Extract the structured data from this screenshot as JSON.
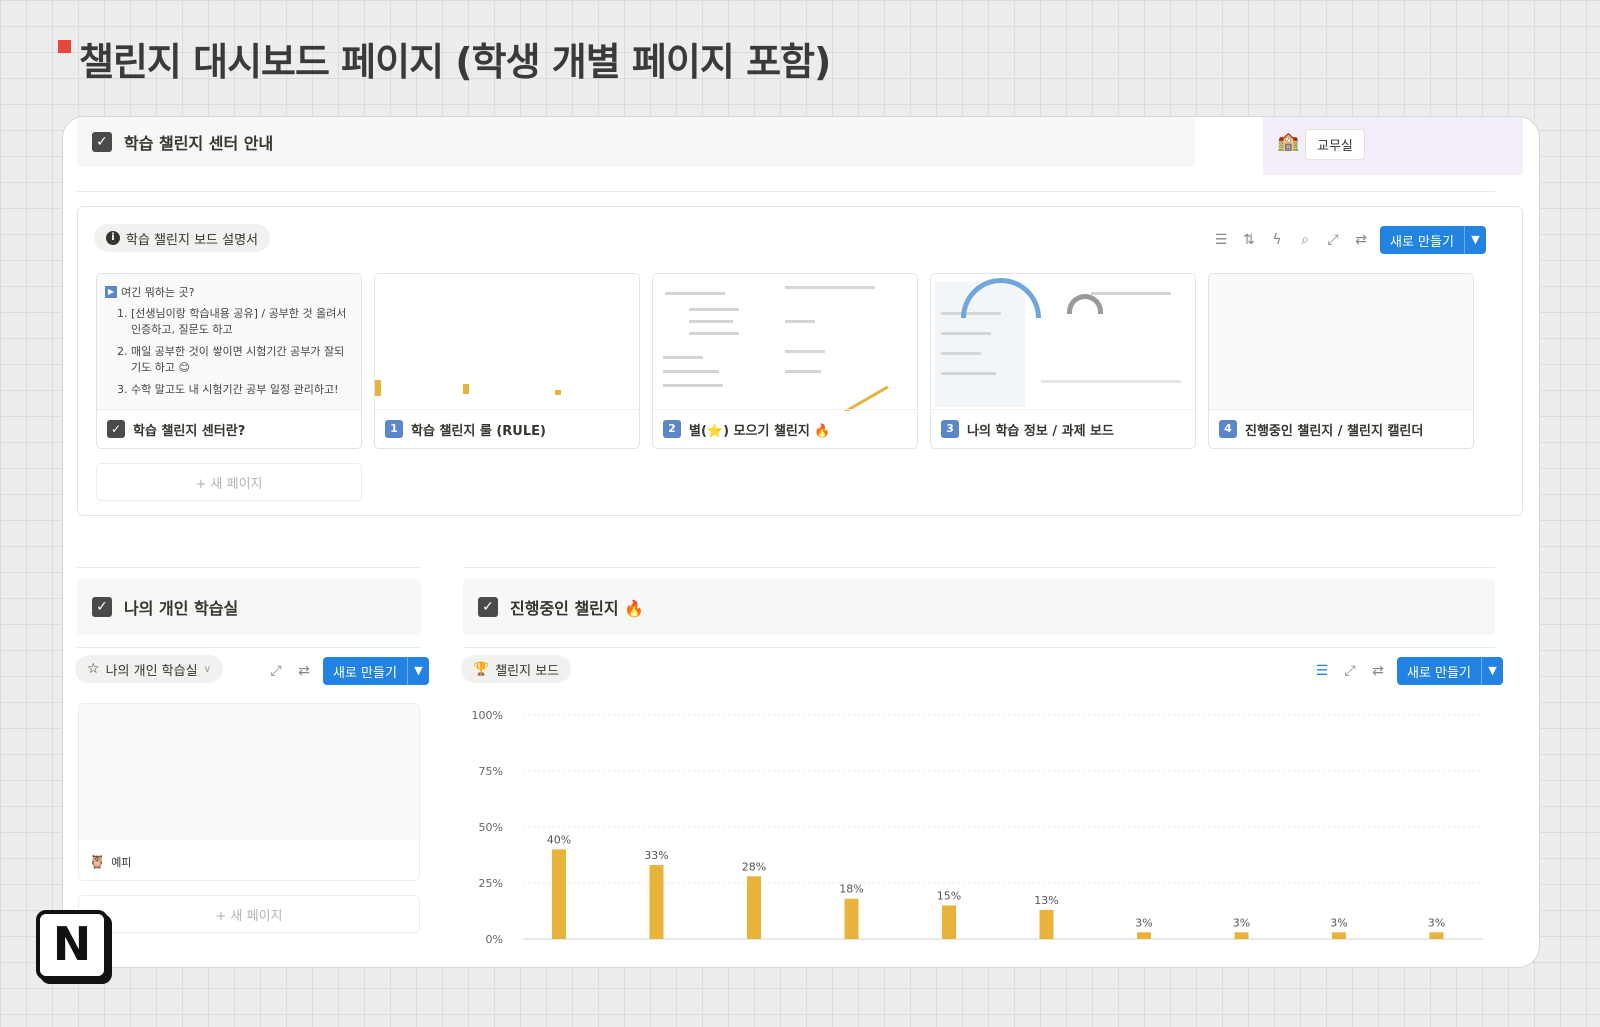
{
  "page": {
    "heading": "챌린지 대시보드 페이지 (학생 개별 페이지 포함)"
  },
  "center_callout": {
    "title": "학습 챌린지 센터 안내",
    "checked": true
  },
  "office": {
    "icon": "school-building-icon",
    "label": "교무실"
  },
  "board": {
    "view_name": "학습 챌린지 보드 설명서",
    "toolbar": {
      "icons": [
        "filter-icon",
        "sort-icon",
        "automation-icon",
        "search-icon",
        "expand-icon",
        "settings-icon"
      ],
      "new_button": "새로 만들기"
    },
    "intro": {
      "heading": "여긴 뭐하는 곳?",
      "items": [
        "[선생님이랑 학습내용 공유] / 공부한 것 올려서 인증하고, 질문도 하고",
        "매일 공부한 것이 쌓이면 시험기간 공부가 잘되기도 하고 😊",
        "수학 말고도 내 시험기간 공부 일정 관리하고!"
      ]
    },
    "cards": [
      {
        "badge": "",
        "title": "학습 챌린지 센터란?"
      },
      {
        "badge": "1",
        "title": "학습 챌린지 룰 (RULE)"
      },
      {
        "badge": "2",
        "title": "별(⭐) 모으기 챌린지 🔥"
      },
      {
        "badge": "3",
        "title": "나의 학습 정보 / 과제 보드"
      },
      {
        "badge": "4",
        "title": "진행중인 챌린지  / 챌린지 캘린더"
      }
    ],
    "new_page": "+ 새 페이지"
  },
  "personal": {
    "callout_title": "나의 개인 학습실",
    "view_name": "나의 개인 학습실",
    "new_button": "새로 만들기",
    "card_title": "예피",
    "new_page": "+ 새 페이지"
  },
  "challenges": {
    "callout_title": "진행중인 챌린지 🔥",
    "view_name": "챌린지 보드",
    "new_button": "새로 만들기"
  },
  "colors": {
    "accent": "#2383e2",
    "bar": "#e7b33a",
    "heading_mark": "#e8453c"
  },
  "chart_data": {
    "type": "bar",
    "y_ticks": [
      "100%",
      "75%",
      "50%",
      "25%",
      "0%"
    ],
    "ylim": [
      0,
      100
    ],
    "values": [
      40,
      33,
      28,
      18,
      15,
      13,
      3,
      3,
      3,
      3
    ],
    "value_labels": [
      "40%",
      "33%",
      "28%",
      "18%",
      "15%",
      "13%",
      "3%",
      "3%",
      "3%",
      "3%"
    ],
    "grid": true
  }
}
